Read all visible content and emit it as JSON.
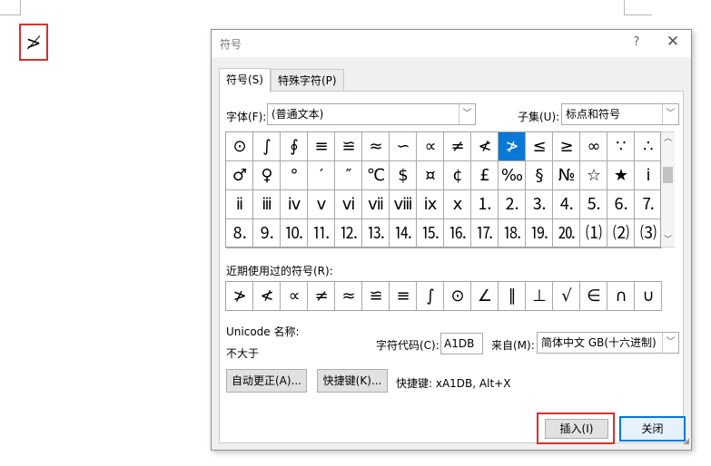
{
  "document": {
    "inserted_char": "≯"
  },
  "dialog": {
    "title": "符号",
    "help_label": "?",
    "close_label": "✕",
    "tabs": [
      {
        "label": "符号(S)",
        "active": true
      },
      {
        "label": "特殊字符(P)",
        "active": false
      }
    ],
    "font_label": "字体(F):",
    "font_value": "(普通文本)",
    "subset_label": "子集(U):",
    "subset_value": "标点和符号",
    "symbols": [
      [
        "⊙",
        "∫",
        "∮",
        "≡",
        "≌",
        "≈",
        "∽",
        "∝",
        "≠",
        "≮",
        "≯",
        "≤",
        "≥",
        "∞",
        "∵",
        "∴"
      ],
      [
        "♂",
        "♀",
        "°",
        "′",
        "″",
        "℃",
        "$",
        "¤",
        "¢",
        "£",
        "‰",
        "§",
        "№",
        "☆",
        "★",
        "ⅰ"
      ],
      [
        "ⅱ",
        "ⅲ",
        "ⅳ",
        "ⅴ",
        "ⅵ",
        "ⅶ",
        "ⅷ",
        "ⅸ",
        "ⅹ",
        "⒈",
        "⒉",
        "⒊",
        "⒋",
        "⒌",
        "⒍",
        "⒎"
      ],
      [
        "⒏",
        "⒐",
        "⒑",
        "⒒",
        "⒓",
        "⒔",
        "⒕",
        "⒖",
        "⒗",
        "⒘",
        "⒙",
        "⒚",
        "⒛",
        "⑴",
        "⑵",
        "⑶"
      ]
    ],
    "selected_symbol": "≯",
    "recent_label": "近期使用过的符号(R):",
    "recent_symbols": [
      "≯",
      "≮",
      "∝",
      "≠",
      "≈",
      "≌",
      "≡",
      "∫",
      "⊙",
      "∠",
      "∥",
      "⊥",
      "√",
      "∈",
      "∩",
      "∪"
    ],
    "unicode_name_label": "Unicode 名称:",
    "unicode_name_value": "不大于",
    "char_code_label": "字符代码(C):",
    "char_code_value": "A1DB",
    "from_label": "来自(M):",
    "from_value": "简体中文 GB(十六进制)",
    "autocorrect_button": "自动更正(A)...",
    "shortcut_button": "快捷键(K)...",
    "shortcut_info": "快捷键: xA1DB, Alt+X",
    "insert_button": "插入(I)",
    "close_button": "关闭",
    "accent_color": "#0a78d7",
    "highlight_color": "#d9302c"
  }
}
